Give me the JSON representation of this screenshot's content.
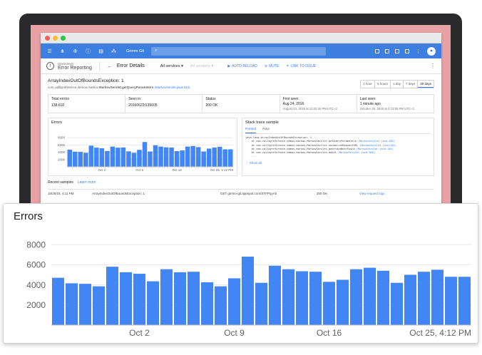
{
  "window": {
    "traffic_colors": [
      "#ff5f57",
      "#febc2e",
      "#28c840"
    ]
  },
  "appbar": {
    "project": "Grimm Git",
    "search_placeholder": "Search"
  },
  "subbar": {
    "product_line1": "Stackdriver",
    "product_line2": "Error Reporting",
    "page_title": "Error Details",
    "services_select": "All services",
    "versions_select": "All versions",
    "auto_reload": "AUTO RELOAD",
    "mute": "MUTE",
    "link_to_issue": "LINK TO ISSUE"
  },
  "error": {
    "title": "ArrayIndexOutOfBoundsException: 1",
    "location_prefix": "com.callbyreference.demos.markov.",
    "location_method": "MarkovServlet.getQueryParameters",
    "location_link": "(MarkovServlet.java:184)"
  },
  "time_range": [
    "1 hour",
    "6 hours",
    "1 day",
    "7 days",
    "30 days"
  ],
  "stats": [
    {
      "label": "Total errors",
      "value": "138,610",
      "sub": ""
    },
    {
      "label": "Seen in",
      "value": "20160622t135605",
      "sub": ""
    },
    {
      "label": "Status",
      "value": "200 OK",
      "sub": ""
    },
    {
      "label": "First seen",
      "value": "Aug 24, 2016",
      "sub": "August 24, 2016 at 11:22:30 PM UTC+2"
    },
    {
      "label": "Last seen",
      "value": "1 minute ago",
      "sub": "October 25, 2016 at 4:12:55 PM UTC+2"
    }
  ],
  "mini_chart_title": "Errors",
  "stack": {
    "title": "Stack trace sample",
    "tab_parsed": "Parsed",
    "tab_raw": "Raw",
    "lines": [
      {
        "text": "java.lang.ArrayIndexOutOfBoundsException: 1",
        "link": ""
      },
      {
        "text": "    at com.callbyreference.demos.markov.MarkovServlet.getQueryParameters ",
        "link": "(MarkovServlet.java:184)"
      },
      {
        "text": "    at com.callbyreference.demos.markov.MarkovServlet.normalizeRequestURL ",
        "link": "(MarkovServlet.java:181)"
      },
      {
        "text": "    at com.callbyreference.demos.markov.MarkovServlet.generateNextFound ",
        "link": "(MarkovServlet.java:144)"
      },
      {
        "text": "    at com.callbyreference.demos.markov.MarkovServlet.doGet ",
        "link": "(MarkovServlet.java:104)"
      },
      {
        "text": "    ...",
        "link": ""
      }
    ],
    "show_all": "Show all"
  },
  "recent": {
    "title": "Recent samples",
    "learn_more": "Learn more",
    "row": {
      "time": "10/25/16, 4:11 PM",
      "exception": "ArrayIndexOutOfBoundsException: 1",
      "request": "GET grimm-git.appspot.com/STFPqyAh",
      "status": "200 OK",
      "view": "View request logs"
    }
  },
  "chart_data": {
    "type": "bar",
    "title": "Errors",
    "ylim": [
      0,
      9000
    ],
    "yticks": [
      2000,
      4000,
      6000,
      8000
    ],
    "grid": true,
    "legend": "none",
    "bar_color": "#4285f4",
    "x_labels": [
      {
        "index": 6,
        "label": "Oct 2"
      },
      {
        "index": 13,
        "label": "Oct 9"
      },
      {
        "index": 20,
        "label": "Oct 16"
      },
      {
        "index": 29,
        "label": "Oct 25, 4:12 PM"
      }
    ],
    "values": [
      4700,
      4150,
      4100,
      3850,
      5800,
      5250,
      5100,
      4350,
      5550,
      5250,
      5300,
      4250,
      3850,
      4650,
      6800,
      4200,
      5900,
      5550,
      5350,
      5300,
      4300,
      4500,
      5550,
      5700,
      5400,
      4200,
      5000,
      5300,
      5500,
      4800,
      4800
    ]
  }
}
